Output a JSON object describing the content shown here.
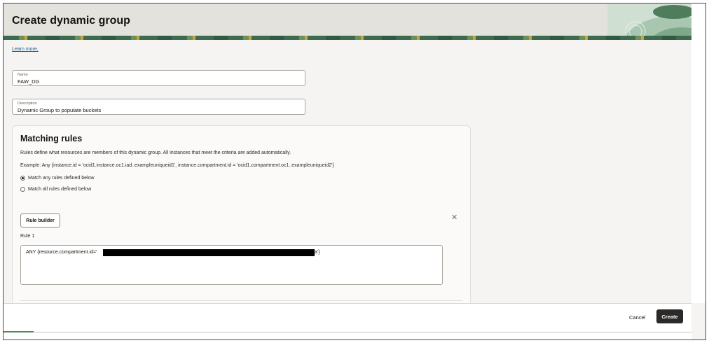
{
  "header": {
    "title": "Create dynamic group"
  },
  "learn_more": "Learn more",
  "learn_more_suffix": ".",
  "name_field": {
    "label": "Name",
    "value": "FAW_DG"
  },
  "description_field": {
    "label": "Description",
    "value": "Dynamic Group to populate buckets"
  },
  "matching_rules": {
    "title": "Matching rules",
    "description": "Rules define what resources are members of this dynamic group. All instances that meet the criteria are added automatically.",
    "example": "Example: Any {instance.id = 'ocid1.instance.oc1.iad..exampleuniqueid1', instance.compartment.id = 'ocid1.compartment.oc1..exampleuniqueid2'}",
    "options": [
      {
        "label": "Match any rules defined below",
        "selected": true
      },
      {
        "label": "Match all rules defined below",
        "selected": false
      }
    ],
    "rule_builder_label": "Rule builder",
    "rule_label": "Rule 1",
    "rule_prefix": "ANY {resource.compartment.id='",
    "rule_suffix": "a'}"
  },
  "footer": {
    "cancel_label": "Cancel",
    "create_label": "Create"
  },
  "colors": {
    "accent": "#2b2a28",
    "link": "#1b5b8a",
    "banner_green": "#3c6b4e"
  }
}
